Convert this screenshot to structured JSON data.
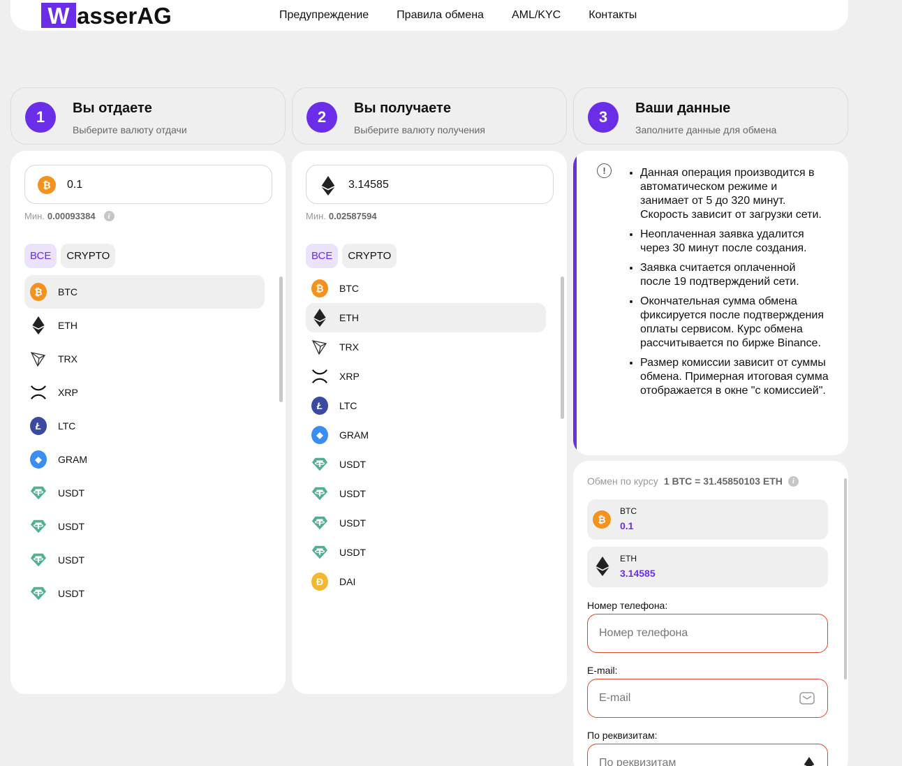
{
  "header": {
    "logo_letter": "W",
    "logo_rest": "asserAG",
    "nav": [
      "Предупреждение",
      "Правила обмена",
      "AML/KYC",
      "Контакты"
    ]
  },
  "steps": [
    {
      "num": "1",
      "title": "Вы отдаете",
      "subtitle": "Выберите валюту отдачи"
    },
    {
      "num": "2",
      "title": "Вы получаете",
      "subtitle": "Выберите валюту получения"
    },
    {
      "num": "3",
      "title": "Ваши данные",
      "subtitle": "Заполните данные для обмена"
    }
  ],
  "give": {
    "amount": "0.1",
    "min_label": "Мин.",
    "min_value": "0.00093384",
    "filters": [
      "ВСЕ",
      "CRYPTO"
    ],
    "currencies": [
      "BTC",
      "ETH",
      "TRX",
      "XRP",
      "LTC",
      "GRAM",
      "USDT",
      "USDT",
      "USDT",
      "USDT"
    ],
    "selected": "BTC"
  },
  "receive": {
    "amount": "3.14585",
    "min_label": "Мин.",
    "min_value": "0.02587594",
    "filters": [
      "ВСЕ",
      "CRYPTO"
    ],
    "currencies": [
      "BTC",
      "ETH",
      "TRX",
      "XRP",
      "LTC",
      "GRAM",
      "USDT",
      "USDT",
      "USDT",
      "USDT",
      "DAI"
    ],
    "selected": "ETH"
  },
  "notice": {
    "items": [
      "Данная операция производится в автоматическом режиме и занимает от 5 до 320 минут. Скорость зависит от загрузки сети.",
      "Неоплаченная заявка удалится через 30 минут после создания.",
      "Заявка считается оплаченной после 19 подтверждений сети.",
      "Окончательная сумма обмена фиксируется после подтверждения оплаты сервисом. Курс обмена рассчитывается по бирже Binance.",
      "Размер комиссии зависит от суммы обмена. Примерная итоговая сумма отображается в окне \"с комиссией\"."
    ]
  },
  "summary": {
    "rate_label": "Обмен по курсу",
    "rate_value": "1 BTC = 31.45850103 ETH",
    "give_currency": "BTC",
    "give_amount": "0.1",
    "receive_currency": "ETH",
    "receive_amount": "3.14585",
    "phone_label": "Номер телефона:",
    "phone_placeholder": "Номер телефона",
    "email_label": "E-mail:",
    "email_placeholder": "E-mail",
    "requisites_label": "По реквизитам:",
    "requisites_placeholder": "По реквизитам"
  },
  "colors": {
    "accent": "#6a2ee8",
    "error_border": "#d84a2f",
    "btc": "#f3921e",
    "usdt": "#53ae94"
  }
}
